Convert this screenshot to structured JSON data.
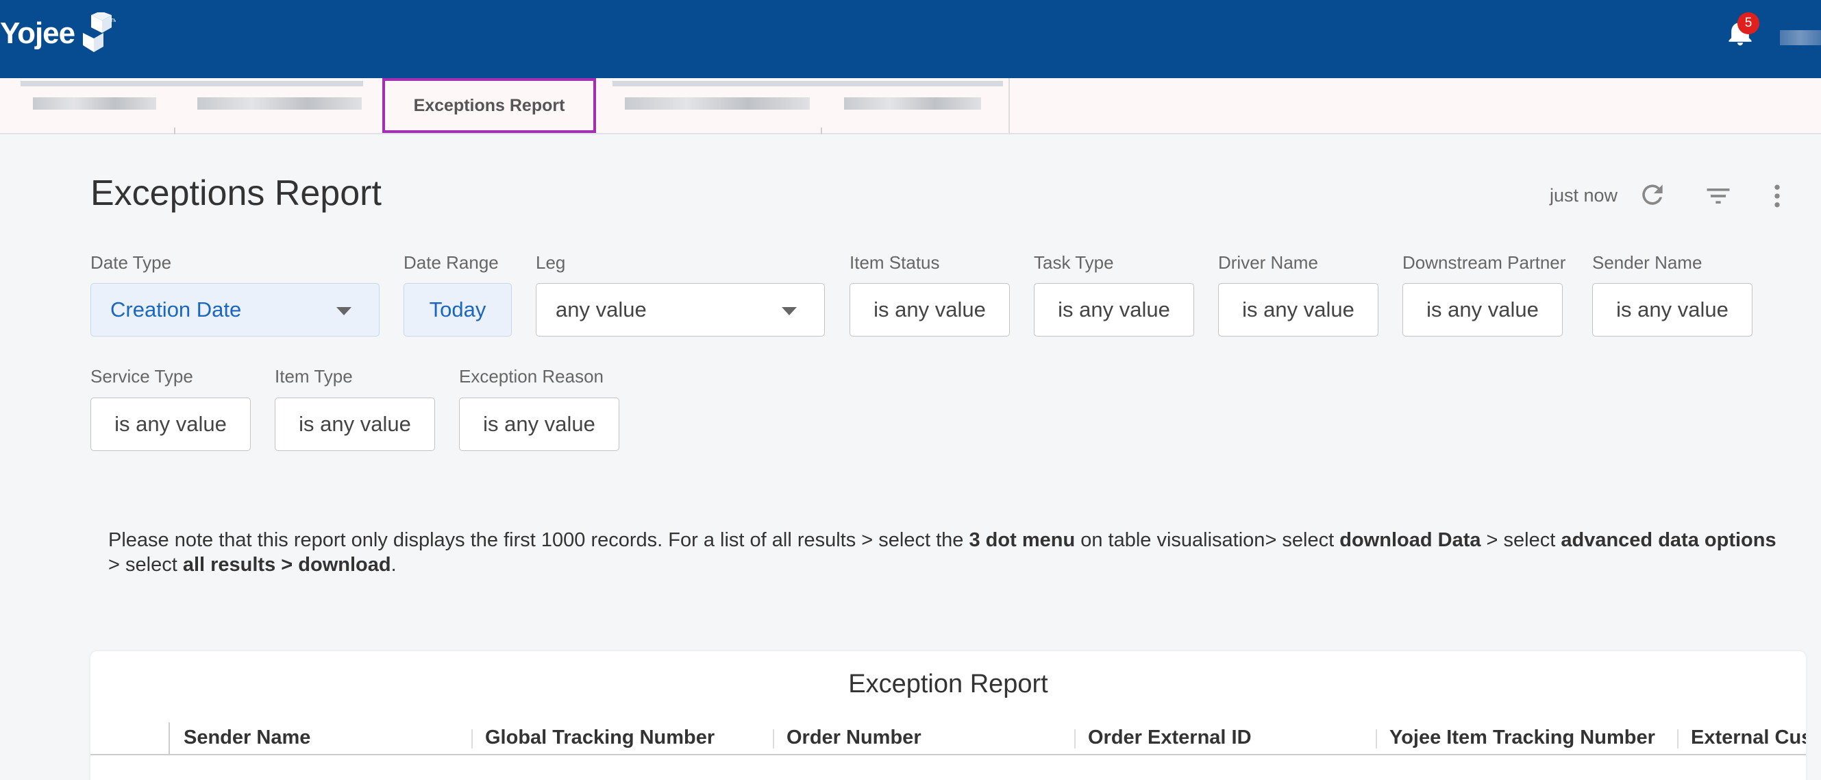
{
  "app": {
    "logo_text": "Yojee",
    "notification_count": "5"
  },
  "tabs": {
    "active_label": "Exceptions Report"
  },
  "header": {
    "title": "Exceptions Report",
    "updated": "just now"
  },
  "filters": [
    {
      "label": "Date Type",
      "value": "Creation Date"
    },
    {
      "label": "Date Range",
      "value": "Today"
    },
    {
      "label": "Leg",
      "value": "any value"
    },
    {
      "label": "Item Status",
      "value": "is any value"
    },
    {
      "label": "Task Type",
      "value": "is any value"
    },
    {
      "label": "Driver Name",
      "value": "is any value"
    },
    {
      "label": "Downstream Partner",
      "value": "is any value"
    },
    {
      "label": "Sender Name",
      "value": "is any value"
    },
    {
      "label": "Service Type",
      "value": "is any value"
    },
    {
      "label": "Item Type",
      "value": "is any value"
    },
    {
      "label": "Exception Reason",
      "value": "is any value"
    }
  ],
  "note": {
    "p1": "Please note that this report only displays the first 1000 records. For a list of all results > select the ",
    "b1": "3 dot menu",
    "p2": " on table visualisation> select ",
    "b2": "download Data",
    "p3": " > select ",
    "b3": "advanced data options",
    "p4": " > select ",
    "b4": "all results > download",
    "p5": "."
  },
  "table": {
    "title": "Exception Report",
    "columns": [
      "Sender Name",
      "Global Tracking Number",
      "Order Number",
      "Order External ID",
      "Yojee Item Tracking Number",
      "External Cus"
    ]
  }
}
